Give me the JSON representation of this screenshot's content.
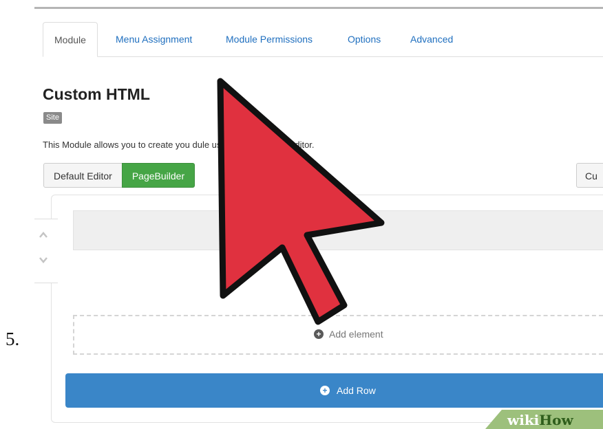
{
  "step_number": "5.",
  "tabs": [
    {
      "label": "Module",
      "active": true
    },
    {
      "label": "Menu Assignment",
      "active": false
    },
    {
      "label": "Module Permissions",
      "active": false
    },
    {
      "label": "Options",
      "active": false
    },
    {
      "label": "Advanced",
      "active": false
    }
  ],
  "module": {
    "title": "Custom HTML",
    "badge": "Site",
    "description": "This Module allows you to create you            dule using a WYSIWYG editor."
  },
  "editor_toggle": {
    "default_label": "Default Editor",
    "pagebuilder_label": "PageBuilder",
    "right_button_label": "Cu"
  },
  "builder": {
    "add_element_label": "Add element",
    "add_row_label": "Add Row",
    "move_up_icon": "chevron-up-icon",
    "move_down_icon": "chevron-down-icon",
    "plus_icon": "plus-circle-icon"
  },
  "overlay": {
    "cursor_icon": "red-arrow-cursor-icon",
    "cursor_color": "#e0313f"
  },
  "watermark": {
    "part1": "wiki",
    "part2": "How"
  },
  "colors": {
    "accent": "#3a86c8",
    "success": "#46a546",
    "link": "#1f6fbf"
  }
}
